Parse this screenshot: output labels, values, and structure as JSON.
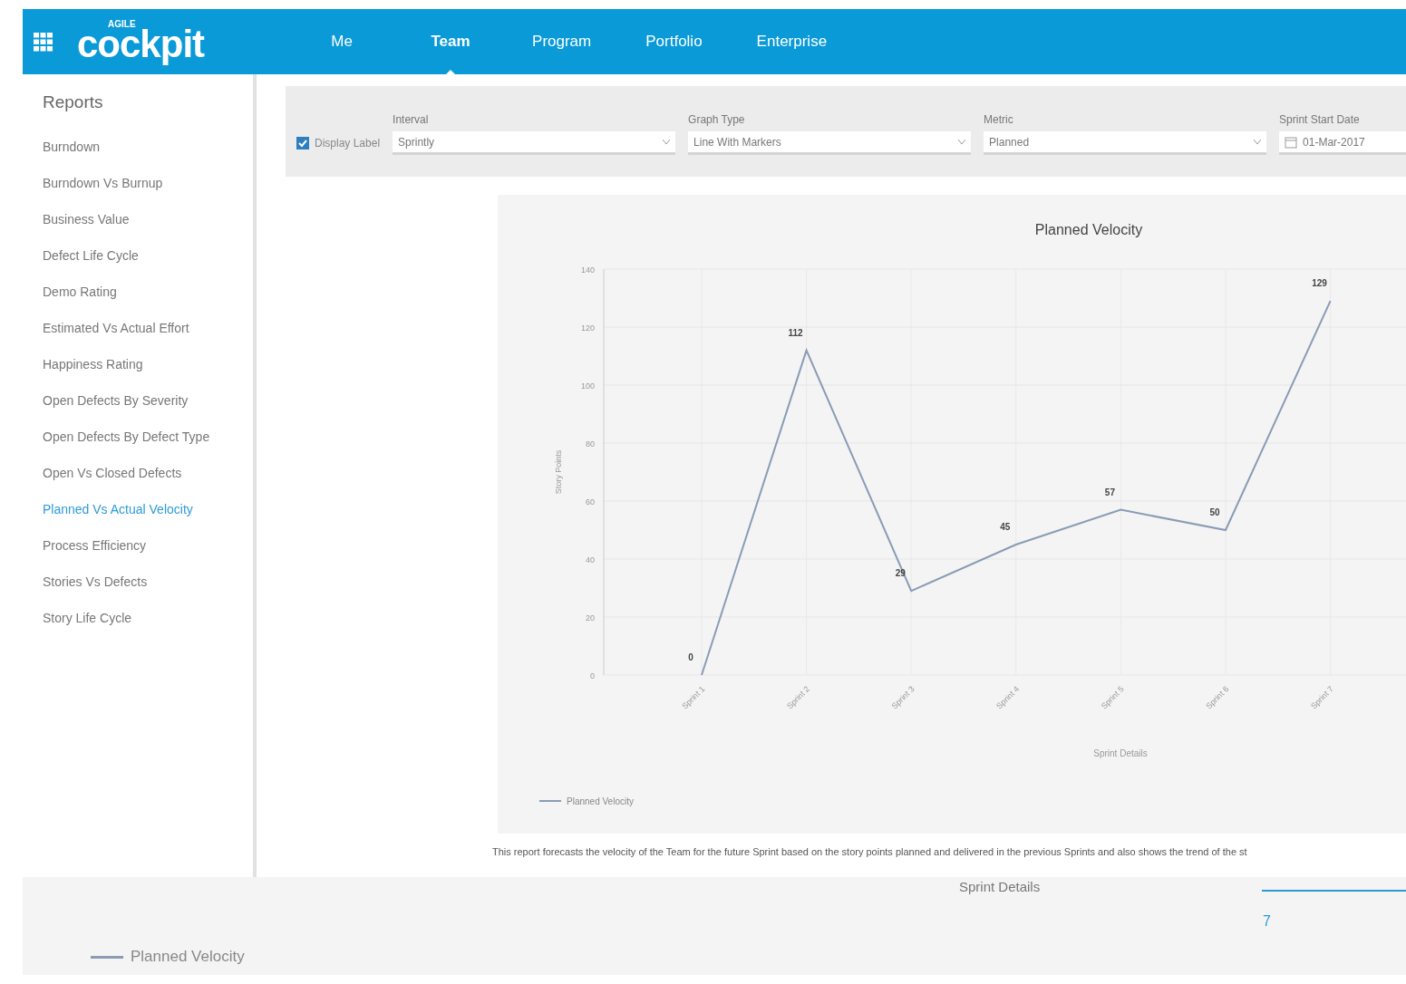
{
  "header": {
    "logo_small": "AGILE",
    "logo": "cockpit",
    "nav": [
      {
        "label": "Me",
        "selected": false
      },
      {
        "label": "Team",
        "selected": true
      },
      {
        "label": "Program",
        "selected": false
      },
      {
        "label": "Portfolio",
        "selected": false
      },
      {
        "label": "Enterprise",
        "selected": false
      }
    ]
  },
  "sidebar": {
    "title": "Reports",
    "items": [
      {
        "label": "Burndown",
        "selected": false
      },
      {
        "label": "Burndown Vs Burnup",
        "selected": false
      },
      {
        "label": "Business Value",
        "selected": false
      },
      {
        "label": "Defect Life Cycle",
        "selected": false
      },
      {
        "label": "Demo Rating",
        "selected": false
      },
      {
        "label": "Estimated Vs Actual Effort",
        "selected": false
      },
      {
        "label": "Happiness Rating",
        "selected": false
      },
      {
        "label": "Open Defects By Severity",
        "selected": false
      },
      {
        "label": "Open Defects By Defect Type",
        "selected": false
      },
      {
        "label": "Open Vs Closed Defects",
        "selected": false
      },
      {
        "label": "Planned Vs Actual Velocity",
        "selected": true
      },
      {
        "label": "Process Efficiency",
        "selected": false
      },
      {
        "label": "Stories Vs Defects",
        "selected": false
      },
      {
        "label": "Story Life Cycle",
        "selected": false
      }
    ]
  },
  "filters": {
    "display_label": {
      "label": "Display Label",
      "checked": true
    },
    "fields": [
      {
        "kind": "select",
        "label": "Interval",
        "value": "Sprintly"
      },
      {
        "kind": "select",
        "label": "Graph Type",
        "value": "Line With Markers"
      },
      {
        "kind": "select",
        "label": "Metric",
        "value": "Planned"
      },
      {
        "kind": "date",
        "label": "Sprint Start Date",
        "value": "01-Mar-2017"
      }
    ]
  },
  "chart": {
    "chart_data": {
      "type": "line",
      "title": "Planned Velocity",
      "xlabel": "Sprint Details",
      "ylabel": "Story Points",
      "categories": [
        "Sprint 1",
        "Sprint 2",
        "Sprint 3",
        "Sprint 4",
        "Sprint 5",
        "Sprint 6",
        "Sprint 7"
      ],
      "series": [
        {
          "name": "Planned Velocity",
          "color": "#8a9bb4",
          "values": [
            0,
            112,
            29,
            45,
            57,
            50,
            129
          ]
        }
      ],
      "ylim": [
        0,
        140
      ],
      "yticks": [
        0,
        20,
        40,
        60,
        80,
        100,
        120,
        140
      ],
      "grid": true,
      "data_labels": true
    }
  },
  "description": "This report forecasts the velocity of the Team for the future Sprint based on the story points planned and delivered in the previous Sprints and also shows the trend of the st",
  "details": {
    "title": "Sprint Details",
    "value": "7",
    "legend": "Planned Velocity"
  }
}
